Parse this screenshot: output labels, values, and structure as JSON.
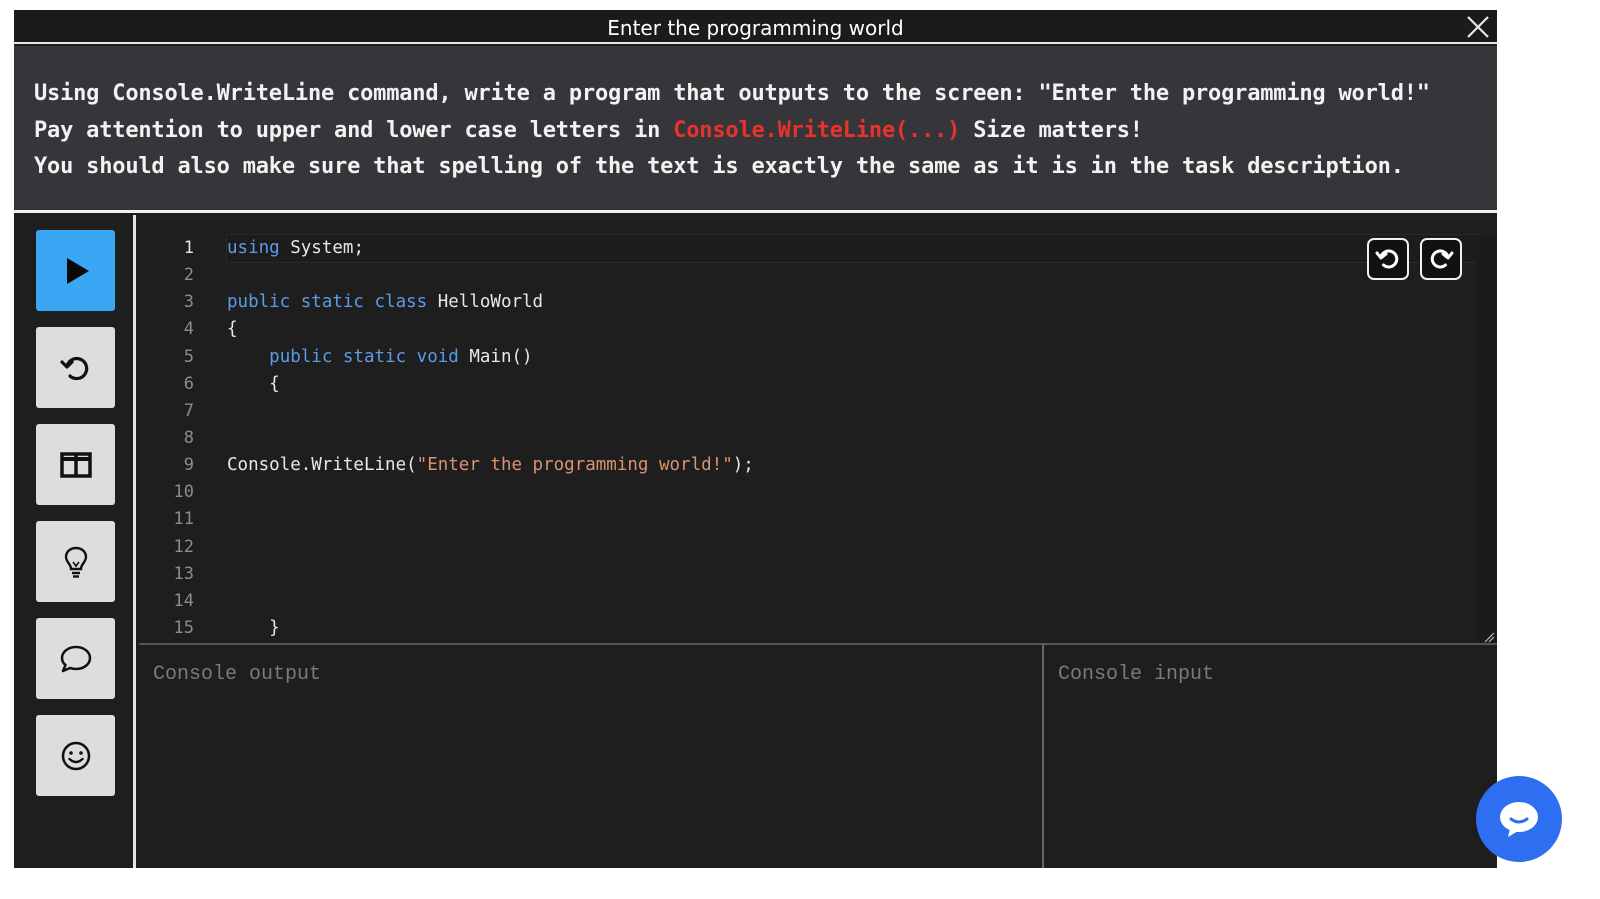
{
  "window": {
    "title": "Enter the programming world",
    "close_icon": "close-icon"
  },
  "task": {
    "line1": "Using Console.WriteLine command, write a program that outputs to the screen: \"Enter the programming world!\"",
    "line2_pre": "Pay attention to upper and lower case letters in ",
    "line2_highlight": "Console.WriteLine(...)",
    "line2_post": " Size matters!",
    "line3": "You should also make sure that spelling of the text is exactly the same as it is in the task description.",
    "highlight_color": "#e8332c"
  },
  "toolbar": {
    "items": [
      {
        "name": "run",
        "icon": "play-icon",
        "color": "#3ba6f3"
      },
      {
        "name": "reset",
        "icon": "reset-icon"
      },
      {
        "name": "layout",
        "icon": "split-layout-icon"
      },
      {
        "name": "hint",
        "icon": "lightbulb-icon"
      },
      {
        "name": "comments",
        "icon": "chat-icon"
      },
      {
        "name": "feedback",
        "icon": "smiley-icon"
      }
    ]
  },
  "editor": {
    "line_numbers": [
      "1",
      "2",
      "3",
      "4",
      "5",
      "6",
      "7",
      "8",
      "9",
      "10",
      "11",
      "12",
      "13",
      "14",
      "15"
    ],
    "lines": {
      "l1_kw": "using",
      "l1_rest": " System;",
      "l3_kw": "public static class",
      "l3_rest": " HelloWorld",
      "l4": "{",
      "l5_indent": "    ",
      "l5_kw": "public static void",
      "l5_rest": " Main()",
      "l6": "    {",
      "l9_pre": "Console.WriteLine(",
      "l9_str": "\"Enter the programming world!\"",
      "l9_post": ");",
      "l15": "    }"
    },
    "undo_icon": "undo-icon",
    "redo_icon": "redo-icon",
    "keyword_color": "#5b9be8",
    "string_color": "#d8946f"
  },
  "console": {
    "output_placeholder": "Console output",
    "input_placeholder": "Console input"
  },
  "chat": {
    "icon": "chat-bubble-icon",
    "color": "#2e6ef0"
  }
}
